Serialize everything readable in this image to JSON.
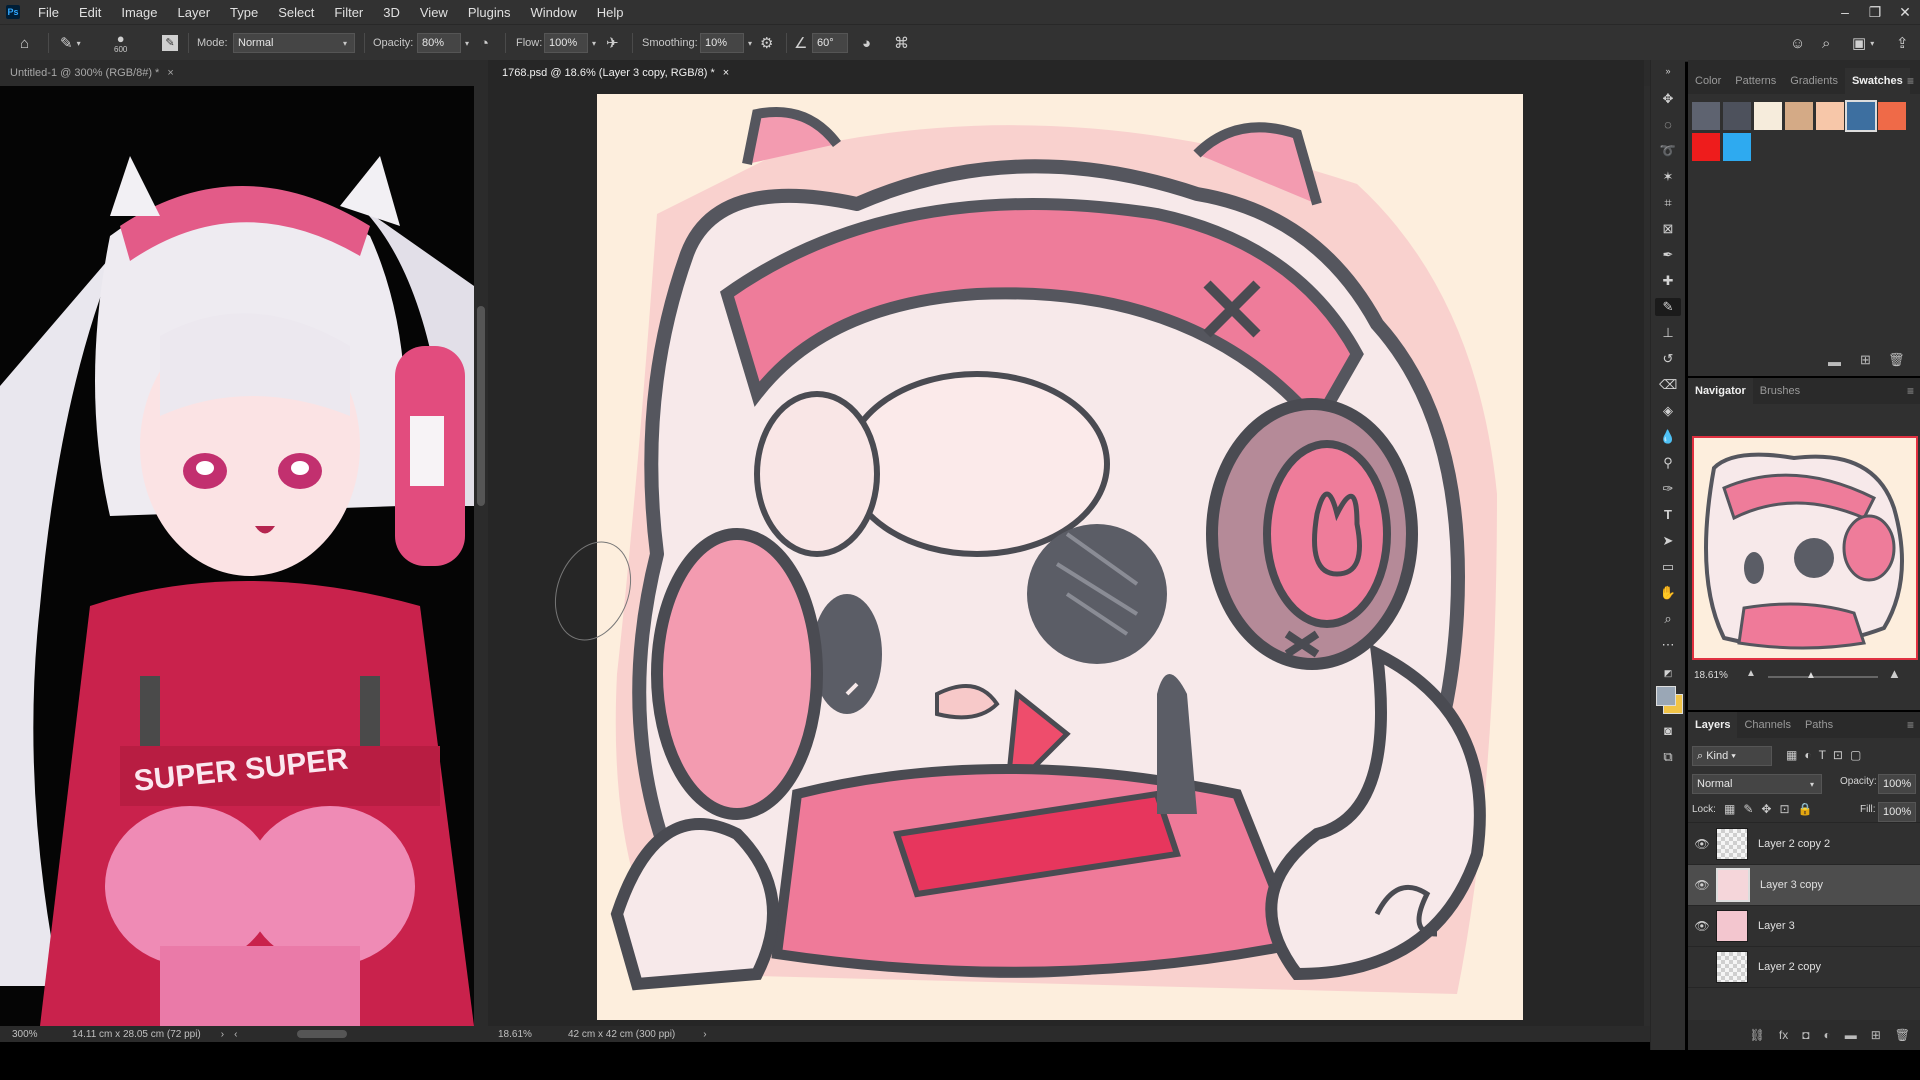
{
  "menu": [
    "File",
    "Edit",
    "Image",
    "Layer",
    "Type",
    "Select",
    "Filter",
    "3D",
    "View",
    "Plugins",
    "Window",
    "Help"
  ],
  "app_logo": "Ps",
  "options": {
    "brush_size": "600",
    "mode_label": "Mode:",
    "mode_value": "Normal",
    "opacity_label": "Opacity:",
    "opacity_value": "80%",
    "flow_label": "Flow:",
    "flow_value": "100%",
    "smoothing_label": "Smoothing:",
    "smoothing_value": "10%",
    "angle_value": "60°"
  },
  "tabs": [
    {
      "label": "Untitled-1 @ 300% (RGB/8#) *",
      "close": "×"
    },
    {
      "label": "1768.psd @ 18.6% (Layer 3 copy, RGB/8) *",
      "close": "×"
    }
  ],
  "status_left": {
    "zoom": "300%",
    "info": "14.11 cm x 28.05 cm (72 ppi)"
  },
  "status_right": {
    "zoom": "18.61%",
    "info": "42 cm x 42 cm (300 ppi)"
  },
  "swatch_panel": {
    "tabs": [
      "Color",
      "Patterns",
      "Gradients",
      "Swatches"
    ],
    "active_tab": "Swatches",
    "colors": [
      "#5e6370",
      "#4d515c",
      "#f6ecdc",
      "#d4aa86",
      "#f7c7a9",
      "#3d6fa0",
      "#ef6a48",
      "#ee1c1c",
      "#2eaaf0"
    ]
  },
  "navigator_panel": {
    "tabs": [
      "Navigator",
      "Brushes"
    ],
    "active_tab": "Navigator",
    "zoom": "18.61%"
  },
  "layers_panel": {
    "tabs": [
      "Layers",
      "Channels",
      "Paths"
    ],
    "active_tab": "Layers",
    "filter": "Kind",
    "blend_mode": "Normal",
    "opacity_label": "Opacity:",
    "opacity_value": "100%",
    "lock_label": "Lock:",
    "fill_label": "Fill:",
    "fill_value": "100%",
    "layers": [
      {
        "name": "Layer 2 copy 2",
        "visible": true,
        "selected": false
      },
      {
        "name": "Layer 3 copy",
        "visible": true,
        "selected": true
      },
      {
        "name": "Layer 3",
        "visible": true,
        "selected": false
      },
      {
        "name": "Layer 2 copy",
        "visible": false,
        "selected": false
      }
    ]
  },
  "colors": {
    "foreground": "#9aa7b6",
    "background": "#f1c448"
  }
}
